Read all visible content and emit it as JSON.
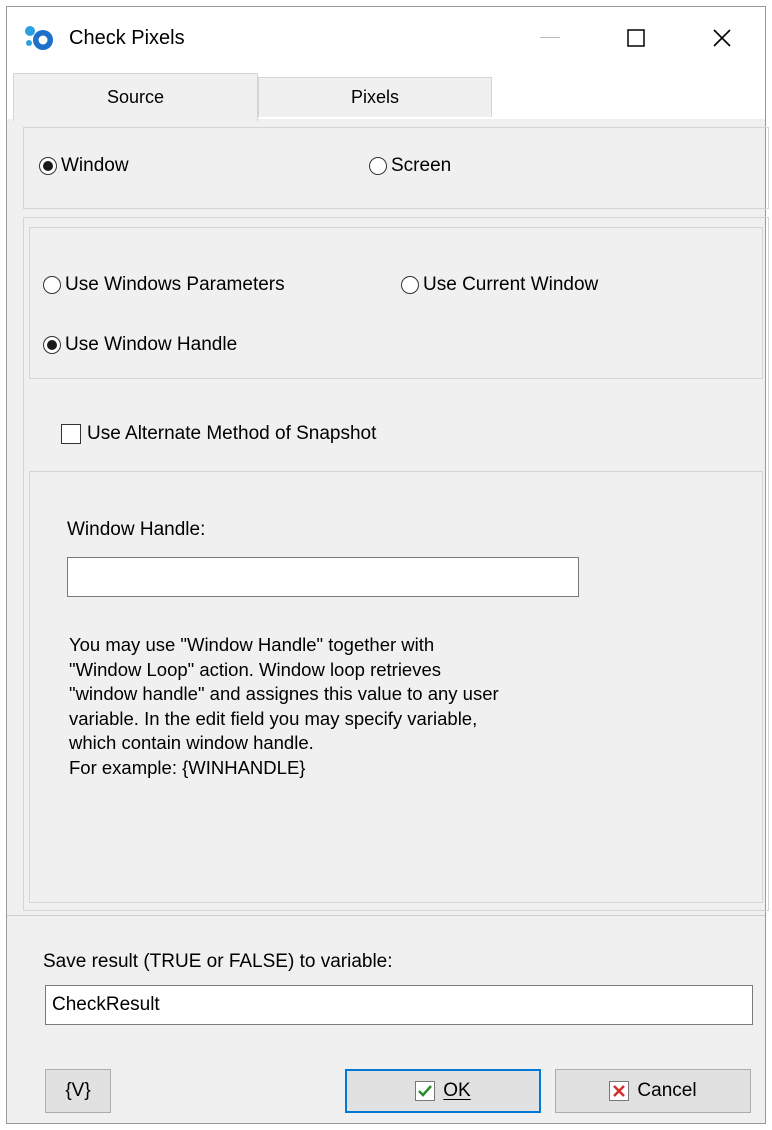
{
  "window": {
    "title": "Check Pixels"
  },
  "tabs": [
    {
      "label": "Source"
    },
    {
      "label": "Pixels"
    }
  ],
  "source_mode": {
    "window_label": "Window",
    "screen_label": "Screen",
    "selected": "Window"
  },
  "window_mode": {
    "use_params_label": "Use Windows Parameters",
    "use_current_label": "Use Current Window",
    "use_handle_label": "Use Window Handle",
    "selected": "Use Window Handle"
  },
  "alternate_snapshot": {
    "label": "Use Alternate Method of Snapshot",
    "checked": false
  },
  "handle": {
    "label": "Window Handle:",
    "value": "",
    "help": "You may use \"Window Handle\" together with\n\"Window Loop\" action. Window loop retrieves\n\"window handle\" and assignes this value to any user\nvariable. In the edit field you may specify variable,\nwhich contain window handle.\nFor example: {WINHANDLE}"
  },
  "result": {
    "label": "Save result (TRUE or FALSE) to variable:",
    "value": "CheckResult"
  },
  "buttons": {
    "var_label": "{V}",
    "ok_label": "OK",
    "cancel_label": "Cancel"
  },
  "icons": {
    "app": "gear-drops-icon",
    "ok": "checkmark-icon",
    "cancel": "cross-icon"
  },
  "colors": {
    "ok_check": "#2e8b2e",
    "cancel_x": "#d0302a",
    "focus_border": "#0078d7"
  }
}
